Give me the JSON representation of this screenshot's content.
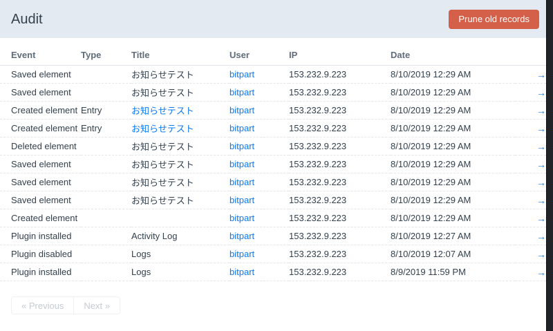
{
  "page": {
    "title": "Audit"
  },
  "header": {
    "prune_button_label": "Prune old records"
  },
  "colors": {
    "header_band": "#e4eaf1",
    "button_red": "#d4604a",
    "link_blue": "#0d78f2",
    "muted_text": "#a3adb8",
    "dark_text": "#33404d"
  },
  "table": {
    "columns": [
      "Event",
      "Type",
      "Title",
      "User",
      "IP",
      "Date"
    ],
    "arrow_icon": "→",
    "rows": [
      {
        "event": "Saved element",
        "type": "",
        "title": "お知らせテスト",
        "title_is_link": false,
        "user": "bitpart",
        "ip": "153.232.9.223",
        "date": "8/10/2019 12:29 AM"
      },
      {
        "event": "Saved element",
        "type": "",
        "title": "お知らせテスト",
        "title_is_link": false,
        "user": "bitpart",
        "ip": "153.232.9.223",
        "date": "8/10/2019 12:29 AM"
      },
      {
        "event": "Created element",
        "type": "Entry",
        "title": "お知らせテスト",
        "title_is_link": true,
        "user": "bitpart",
        "ip": "153.232.9.223",
        "date": "8/10/2019 12:29 AM"
      },
      {
        "event": "Created element",
        "type": "Entry",
        "title": "お知らせテスト",
        "title_is_link": true,
        "user": "bitpart",
        "ip": "153.232.9.223",
        "date": "8/10/2019 12:29 AM"
      },
      {
        "event": "Deleted element",
        "type": "",
        "title": "お知らせテスト",
        "title_is_link": false,
        "user": "bitpart",
        "ip": "153.232.9.223",
        "date": "8/10/2019 12:29 AM"
      },
      {
        "event": "Saved element",
        "type": "",
        "title": "お知らせテスト",
        "title_is_link": false,
        "user": "bitpart",
        "ip": "153.232.9.223",
        "date": "8/10/2019 12:29 AM"
      },
      {
        "event": "Saved element",
        "type": "",
        "title": "お知らせテスト",
        "title_is_link": false,
        "user": "bitpart",
        "ip": "153.232.9.223",
        "date": "8/10/2019 12:29 AM"
      },
      {
        "event": "Saved element",
        "type": "",
        "title": "お知らせテスト",
        "title_is_link": false,
        "user": "bitpart",
        "ip": "153.232.9.223",
        "date": "8/10/2019 12:29 AM"
      },
      {
        "event": "Created element",
        "type": "",
        "title": "",
        "title_is_link": false,
        "user": "bitpart",
        "ip": "153.232.9.223",
        "date": "8/10/2019 12:29 AM"
      },
      {
        "event": "Plugin installed",
        "type": "",
        "title": "Activity Log",
        "title_is_link": false,
        "user": "bitpart",
        "ip": "153.232.9.223",
        "date": "8/10/2019 12:27 AM"
      },
      {
        "event": "Plugin disabled",
        "type": "",
        "title": "Logs",
        "title_is_link": false,
        "user": "bitpart",
        "ip": "153.232.9.223",
        "date": "8/10/2019 12:07 AM"
      },
      {
        "event": "Plugin installed",
        "type": "",
        "title": "Logs",
        "title_is_link": false,
        "user": "bitpart",
        "ip": "153.232.9.223",
        "date": "8/9/2019 11:59 PM"
      }
    ]
  },
  "pagination": {
    "previous_label": "« Previous",
    "next_label": "Next »"
  }
}
